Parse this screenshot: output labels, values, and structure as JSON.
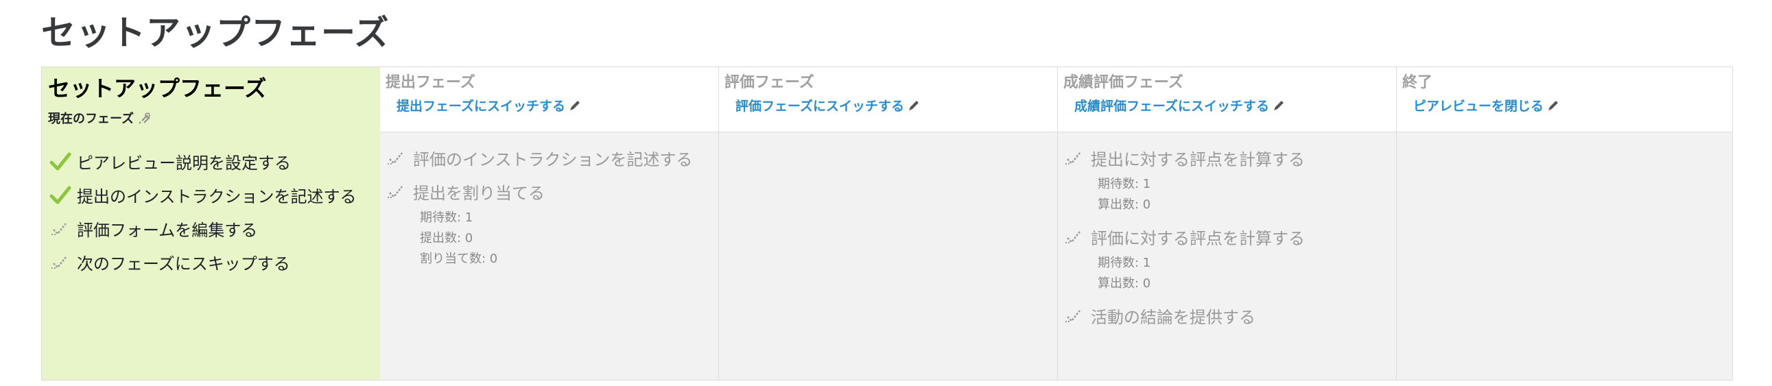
{
  "page_title": "セットアップフェーズ",
  "phases": [
    {
      "title": "セットアップフェーズ",
      "current_label": "現在のフェーズ",
      "tasks": [
        {
          "label": "ピアレビュー説明を設定する",
          "status": "done"
        },
        {
          "label": "提出のインストラクションを記述する",
          "status": "done"
        },
        {
          "label": "評価フォームを編集する",
          "status": "todo"
        },
        {
          "label": "次のフェーズにスキップする",
          "status": "todo"
        }
      ]
    },
    {
      "title": "提出フェーズ",
      "switch_label": "提出フェーズにスイッチする",
      "tasks": [
        {
          "label": "評価のインストラクションを記述する",
          "status": "todo"
        },
        {
          "label": "提出を割り当てる",
          "status": "todo",
          "details": [
            "期待数: 1",
            "提出数: 0",
            "割り当て数: 0"
          ]
        }
      ]
    },
    {
      "title": "評価フェーズ",
      "switch_label": "評価フェーズにスイッチする",
      "tasks": []
    },
    {
      "title": "成績評価フェーズ",
      "switch_label": "成績評価フェーズにスイッチする",
      "tasks": [
        {
          "label": "提出に対する評点を計算する",
          "status": "todo",
          "details": [
            "期待数: 1",
            "算出数: 0"
          ]
        },
        {
          "label": "評価に対する評点を計算する",
          "status": "todo",
          "details": [
            "期待数: 1",
            "算出数: 0"
          ]
        },
        {
          "label": "活動の結論を提供する",
          "status": "todo"
        }
      ]
    },
    {
      "title": "終了",
      "switch_label": "ピアレビューを閉じる",
      "tasks": []
    }
  ],
  "colors": {
    "active_bg": "#e8f5c8",
    "inactive_bg": "#f2f2f2",
    "link": "#2c8ccb",
    "check_done": "#8cc63f",
    "check_todo": "#9a9a9a"
  }
}
